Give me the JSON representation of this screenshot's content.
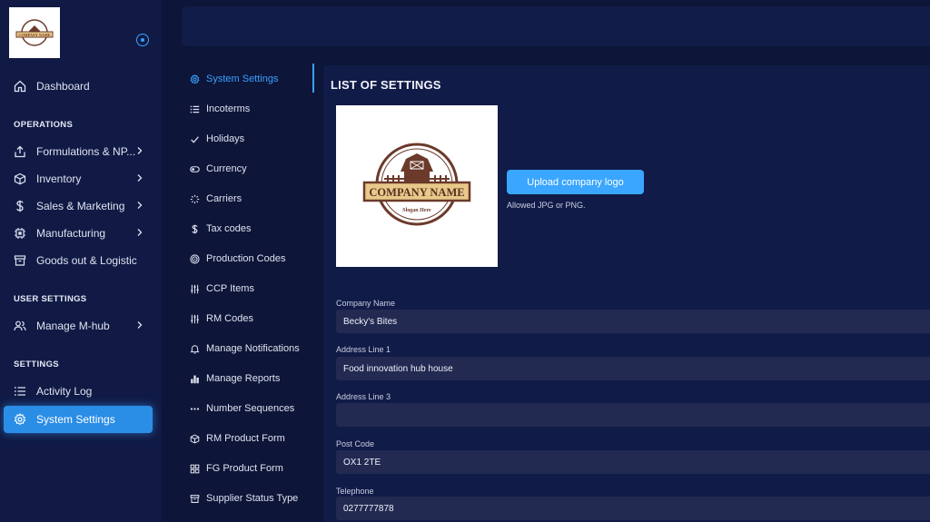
{
  "sidebar": {
    "company_logo": {
      "name": "COMPANY NAME"
    },
    "dashboard": "Dashboard",
    "sections": {
      "operations": "OPERATIONS",
      "user_settings": "USER SETTINGS",
      "settings": "SETTINGS"
    },
    "operations_items": [
      "Formulations & NP...",
      "Inventory",
      "Sales & Marketing",
      "Manufacturing",
      "Goods out & Logistic"
    ],
    "user_items": [
      "Manage M-hub"
    ],
    "settings_items": [
      "Activity Log",
      "System Settings"
    ],
    "active_item": "System Settings"
  },
  "settings_menu": {
    "active": "System Settings",
    "items": [
      "System Settings",
      "Incoterms",
      "Holidays",
      "Currency",
      "Carriers",
      "Tax codes",
      "Production Codes",
      "CCP Items",
      "RM Codes",
      "Manage Notifications",
      "Manage Reports",
      "Number Sequences",
      "RM Product Form",
      "FG Product Form",
      "Supplier Status Type"
    ]
  },
  "main": {
    "title": "LIST OF SETTINGS",
    "logo": {
      "name": "COMPANY NAME",
      "slogan": "Slogan Here"
    },
    "upload_button": "Upload company logo",
    "upload_hint": "Allowed JPG or PNG.",
    "fields": [
      {
        "label": "Company Name",
        "value": "Becky's Bites"
      },
      {
        "label": "Address Line 1",
        "value": "Food innovation hub house"
      },
      {
        "label": "Address Line 3",
        "value": ""
      },
      {
        "label": "Post Code",
        "value": "OX1 2TE"
      },
      {
        "label": "Telephone",
        "value": "0277777878"
      }
    ]
  },
  "colors": {
    "background": "#0d1538",
    "sidebar": "#101a45",
    "accent": "#3aa0ff",
    "active_item": "#2a8de6",
    "input_bg": "#222a52",
    "logo_brown": "#6b3a2a",
    "logo_tan": "#e9c98a"
  },
  "icons": {
    "dashboard": "home-icon",
    "formulations": "share-up-icon",
    "inventory": "cube-icon",
    "sales": "dollar-icon",
    "manufacturing": "cpu-icon",
    "goods_out": "archive-icon",
    "manage_mhub": "users-icon",
    "activity_log": "list-icon",
    "system_settings": "gear-icon"
  }
}
